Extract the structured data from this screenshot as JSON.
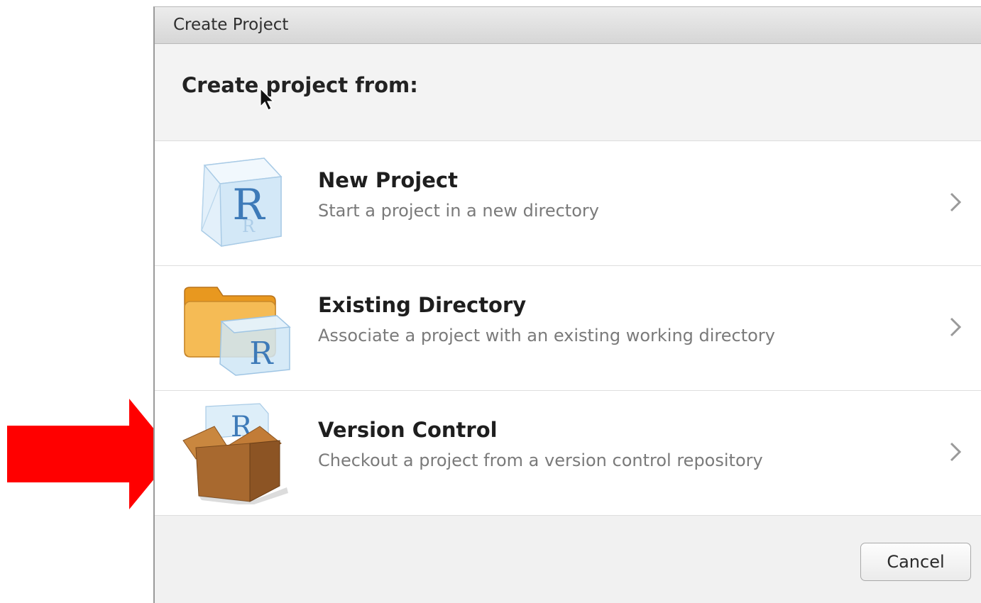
{
  "dialog": {
    "title": "Create Project",
    "heading": "Create project from:"
  },
  "options": [
    {
      "title": "New Project",
      "description": "Start a project in a new directory",
      "icon": "r-cube-icon"
    },
    {
      "title": "Existing Directory",
      "description": "Associate a project with an existing working directory",
      "icon": "folder-r-icon"
    },
    {
      "title": "Version Control",
      "description": "Checkout a project from a version control repository",
      "icon": "box-r-icon"
    }
  ],
  "footer": {
    "cancel_label": "Cancel"
  },
  "colors": {
    "annotation_arrow": "#ff0000",
    "r_blue": "#3d7ab8",
    "cube_fill": "#cfe4f4",
    "folder_orange": "#f0a93a",
    "box_brown": "#a8692f"
  }
}
